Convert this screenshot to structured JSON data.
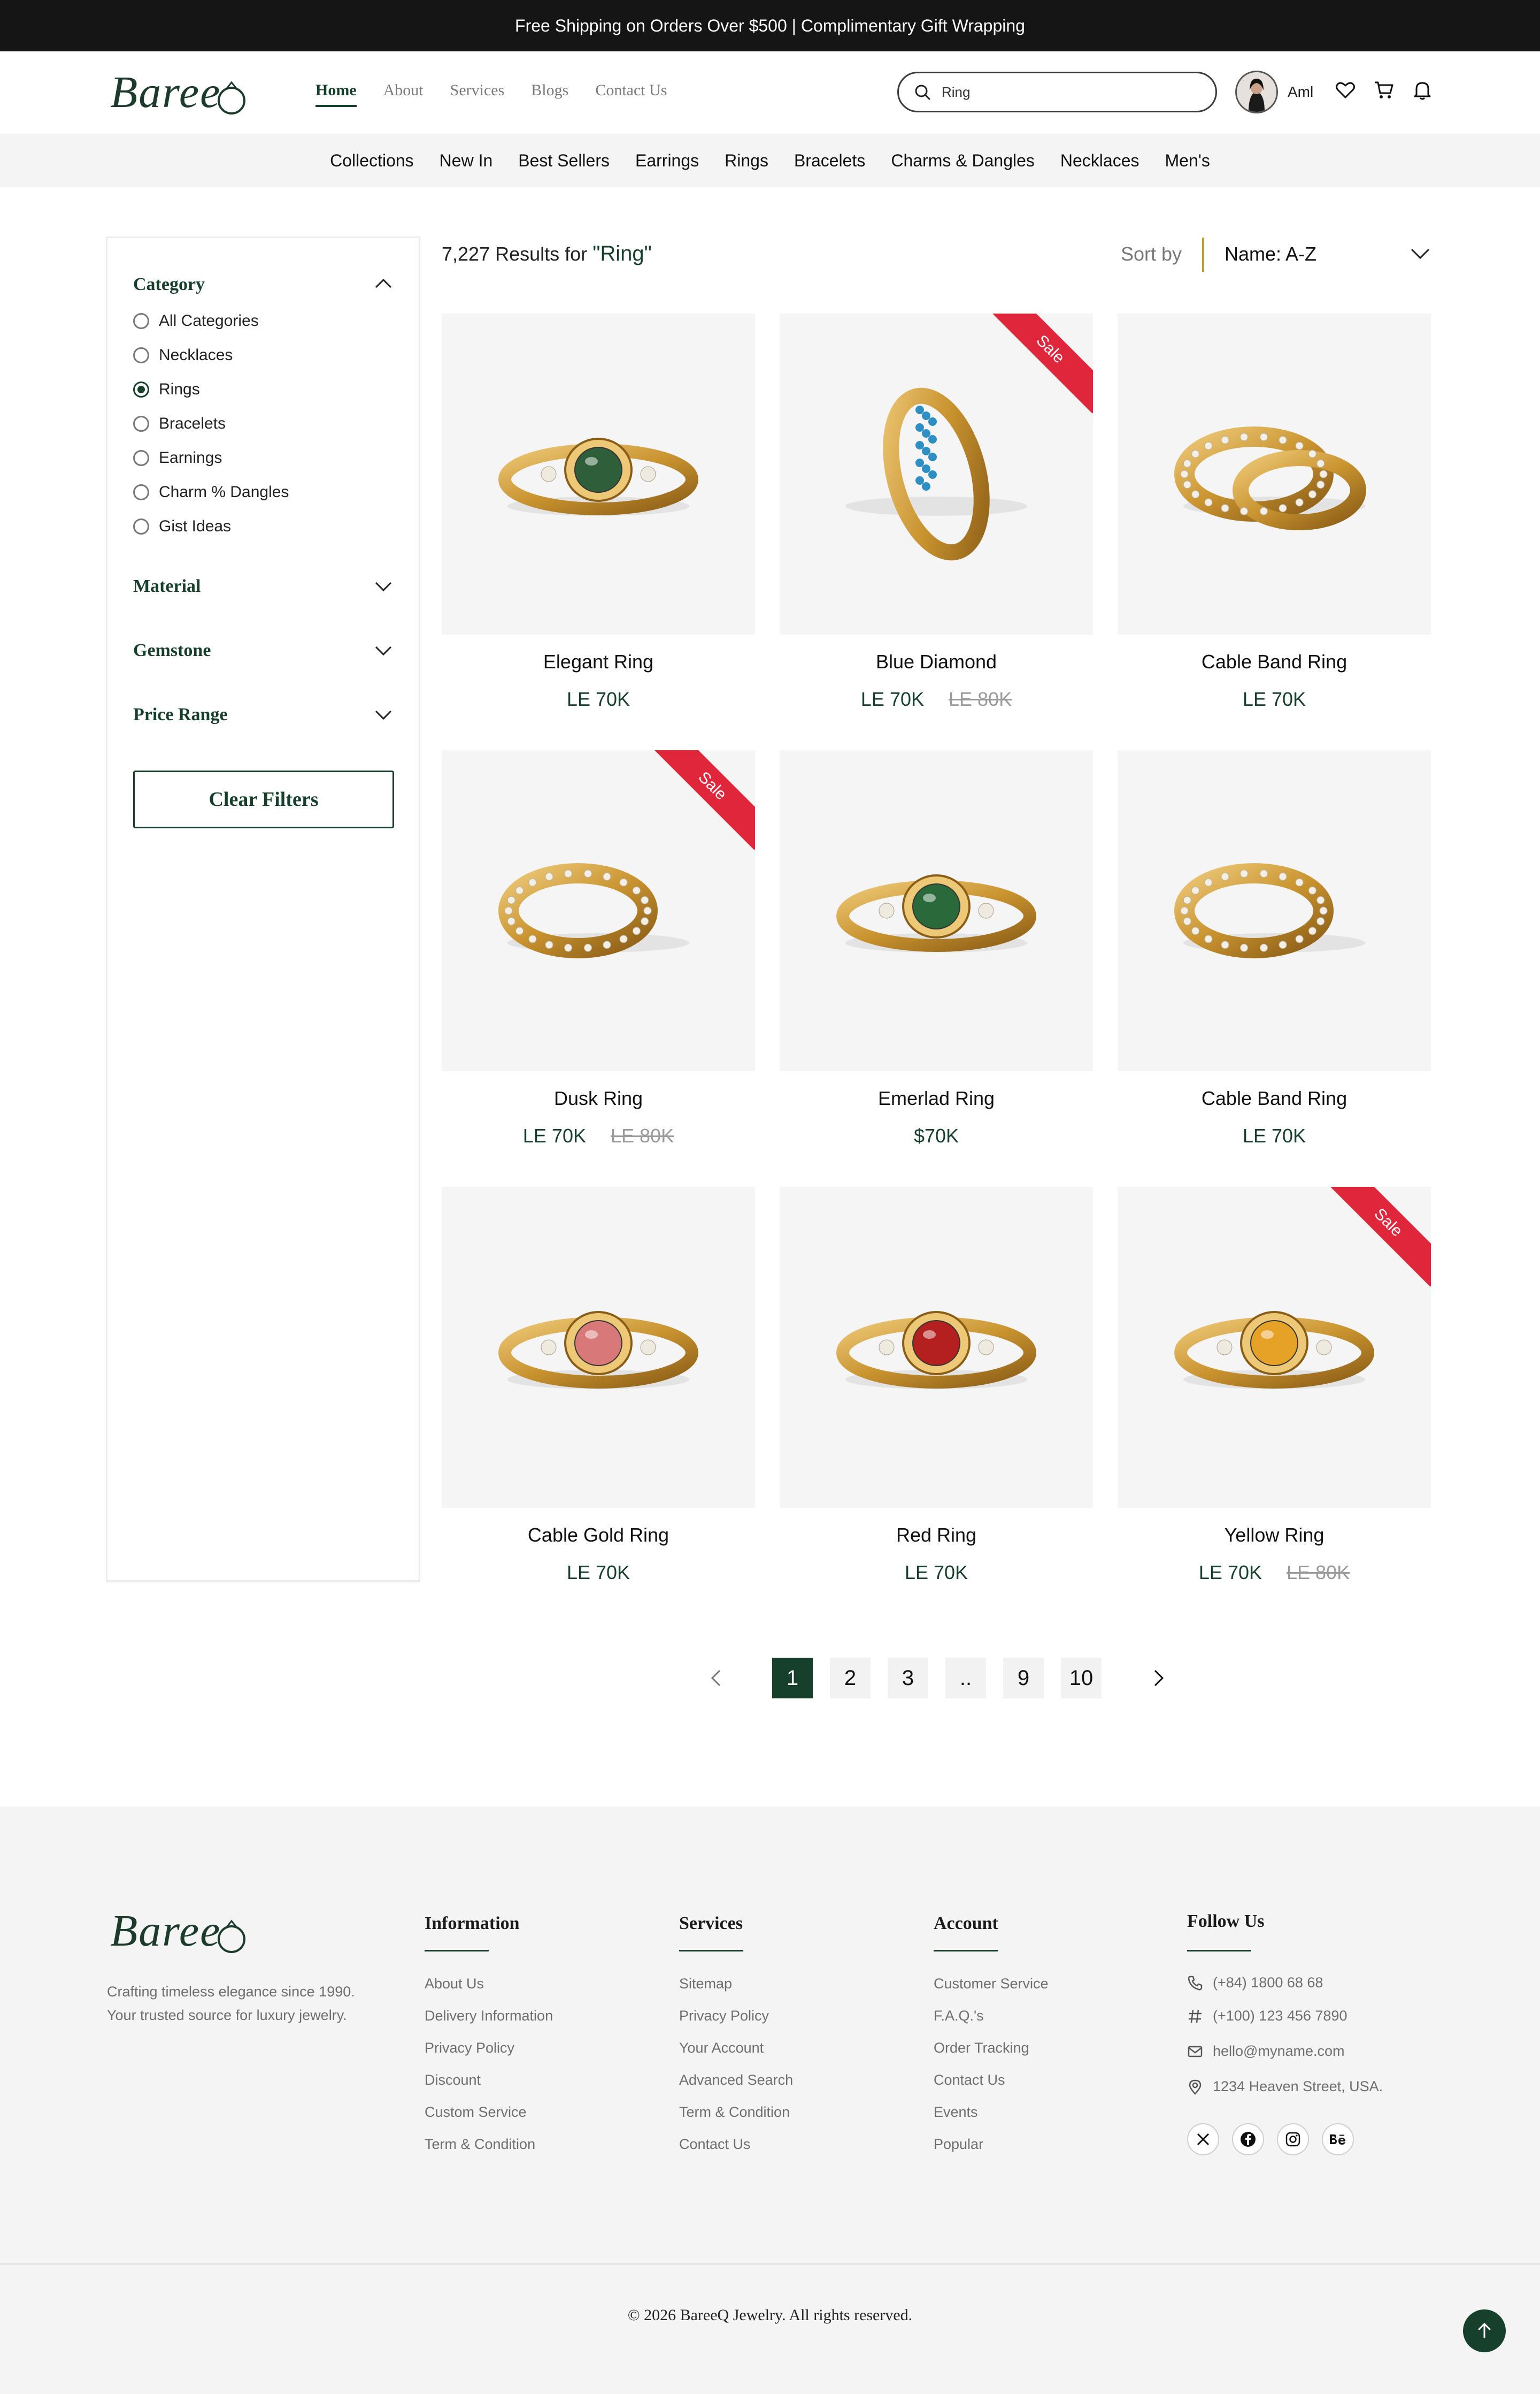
{
  "announcement": "Free Shipping on Orders Over $500 | Complimentary Gift Wrapping",
  "brand": {
    "name": "Baree",
    "accent": "#163f2c",
    "sale_color": "#e0263a"
  },
  "nav": [
    {
      "label": "Home",
      "active": true
    },
    {
      "label": "About"
    },
    {
      "label": "Services"
    },
    {
      "label": "Blogs"
    },
    {
      "label": "Contact Us"
    }
  ],
  "search": {
    "value": "Ring",
    "icon": "search-icon"
  },
  "user": {
    "name": "Aml"
  },
  "header_icons": [
    "heart-icon",
    "cart-icon",
    "bell-icon"
  ],
  "categories": [
    "Collections",
    "New In",
    "Best Sellers",
    "Earrings",
    "Rings",
    "Bracelets",
    "Charms & Dangles",
    "Necklaces",
    "Men's"
  ],
  "filters": {
    "category": {
      "title": "Category",
      "options": [
        "All Categories",
        "Necklaces",
        "Rings",
        "Bracelets",
        "Earnings",
        "Charm % Dangles",
        "Gist Ideas"
      ],
      "selected": "Rings"
    },
    "collapsed": [
      "Material",
      "Gemstone",
      "Price Range"
    ],
    "clear_label": "Clear Filters"
  },
  "results": {
    "count": "7,227",
    "prefix": "Results for",
    "query": "\"Ring\""
  },
  "sort": {
    "label": "Sort by",
    "value": "Name: A-Z"
  },
  "sale_label": "Sale",
  "products": [
    {
      "name": "Elegant Ring",
      "price": "LE 70K",
      "old_price": "",
      "sale": false,
      "stone": "#2f5e3a"
    },
    {
      "name": "Blue Diamond",
      "price": "LE 70K",
      "old_price": "LE 80K",
      "sale": true,
      "stone": "#2e8fc4"
    },
    {
      "name": "Cable Band Ring",
      "price": "LE 70K",
      "old_price": "",
      "sale": false,
      "stone": "#e8e2d2"
    },
    {
      "name": "Dusk Ring",
      "price": "LE 70K",
      "old_price": "LE 80K",
      "sale": true,
      "stone": "#e8e2d2"
    },
    {
      "name": "Emerlad Ring",
      "price": "$70K",
      "old_price": "",
      "sale": false,
      "stone": "#2a6a3a"
    },
    {
      "name": "Cable Band Ring",
      "price": "LE 70K",
      "old_price": "",
      "sale": false,
      "stone": "#e8e2d2"
    },
    {
      "name": "Cable Gold Ring",
      "price": "LE 70K",
      "old_price": "",
      "sale": false,
      "stone": "#d97878"
    },
    {
      "name": "Red Ring",
      "price": "LE 70K",
      "old_price": "",
      "sale": false,
      "stone": "#b3201f"
    },
    {
      "name": "Yellow Ring",
      "price": "LE 70K",
      "old_price": "LE 80K",
      "sale": true,
      "stone": "#e6a127"
    }
  ],
  "pagination": {
    "pages": [
      "1",
      "2",
      "3",
      "..",
      "9",
      "10"
    ],
    "current": "1"
  },
  "footer": {
    "tagline_1": "Crafting timeless elegance since 1990.",
    "tagline_2": "Your trusted source for luxury jewelry.",
    "columns": [
      {
        "title": "Information",
        "links": [
          "About Us",
          "Delivery Information",
          "Privacy Policy",
          "Discount",
          "Custom Service",
          "Term & Condition"
        ]
      },
      {
        "title": "Services",
        "links": [
          "Sitemap",
          "Privacy Policy",
          "Your Account",
          "Advanced Search",
          "Term & Condition",
          "Contact Us"
        ]
      },
      {
        "title": "Account",
        "links": [
          "Customer Service",
          "F.A.Q.'s",
          "Order Tracking",
          "Contact Us",
          "Events",
          "Popular"
        ]
      }
    ],
    "follow": {
      "title": "Follow Us",
      "phone": "(+84) 1800 68 68",
      "fax": "(+100) 123 456 7890",
      "email": "hello@myname.com",
      "address": "1234 Heaven Street, USA.",
      "socials": [
        "x-icon",
        "facebook-icon",
        "instagram-icon",
        "behance-icon"
      ]
    },
    "copyright": "© 2026 BareeQ Jewelry. All rights reserved."
  }
}
